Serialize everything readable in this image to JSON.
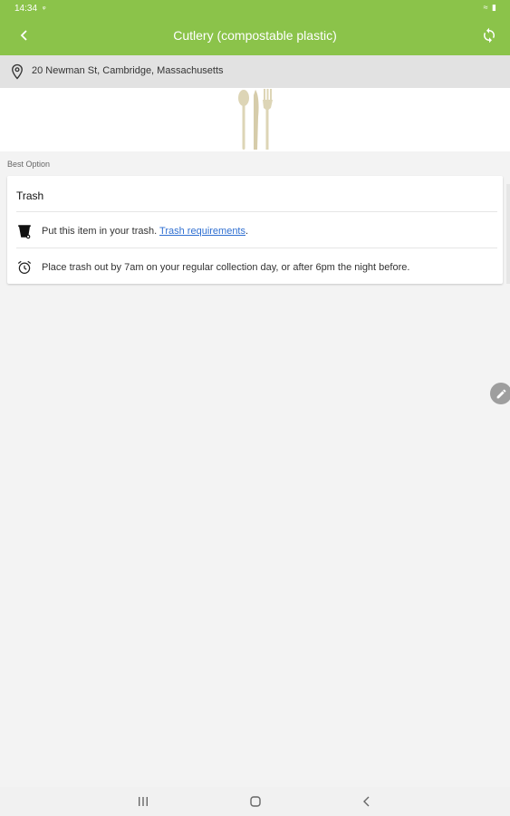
{
  "status_bar": {
    "time": "14:34",
    "indicator": "ᵠ",
    "right": "≈ ▮"
  },
  "app_bar": {
    "title": "Cutlery (compostable plastic)",
    "back_icon": "chevron-left-icon",
    "refresh_icon": "sync-icon",
    "color": "#8bc34a"
  },
  "location": {
    "address": "20 Newman St, Cambridge, Massachusetts",
    "icon": "location-pin-icon"
  },
  "item": {
    "image": "cutlery-image"
  },
  "best_option": {
    "section_label": "Best Option",
    "title": "Trash",
    "rows": [
      {
        "icon": "trash-bin-icon",
        "text": "Put this item in your trash.",
        "link_text": "Trash requirements",
        "suffix": "."
      },
      {
        "icon": "alarm-clock-icon",
        "text": "Place trash out by 7am on your regular collection day, or after 6pm the night before."
      }
    ]
  },
  "fab": {
    "icon": "pencil-icon"
  },
  "nav_bar": {
    "recent_icon": "recent-apps-icon",
    "home_icon": "home-icon",
    "back_icon": "back-icon"
  }
}
